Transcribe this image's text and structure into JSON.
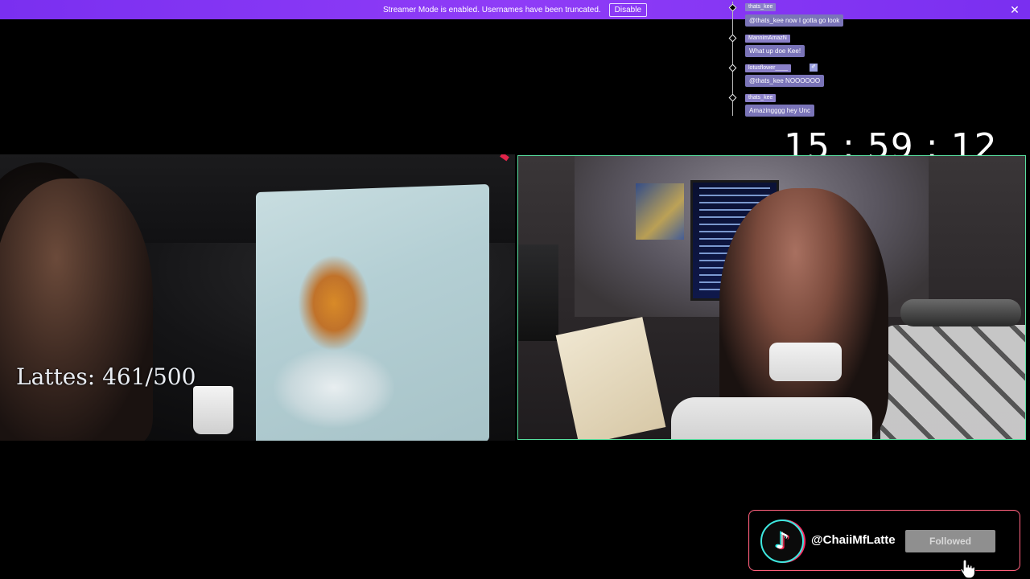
{
  "banner": {
    "message": "Streamer Mode is enabled. Usernames have been truncated.",
    "disable_label": "Disable",
    "close_glyph": "✕",
    "color": "#8f3cf7"
  },
  "chat": {
    "messages": [
      {
        "user": "thats_kee",
        "text": "@thats_kee now I gotta go look"
      },
      {
        "user": "MannimAmazN",
        "text": "What up doe Kee!"
      },
      {
        "user": "lotusflower____",
        "badge": "✐",
        "text": "@thats_kee NOOOOOO"
      },
      {
        "user": "thats_kee",
        "text": "Amazingggg hey Unc"
      }
    ]
  },
  "timer": {
    "text": "15 : 59 : 12"
  },
  "goal": {
    "text": "Lattes: 461/500",
    "current": 461,
    "target": 500
  },
  "follow_card": {
    "platform_icon": "tiktok-icon",
    "logo_glyph": "♪",
    "handle": "@ChaiiMfLatte",
    "button_label": "Followed",
    "accent": "#ff5d7a"
  },
  "cam_right": {
    "border_color": "#58e0a0"
  }
}
